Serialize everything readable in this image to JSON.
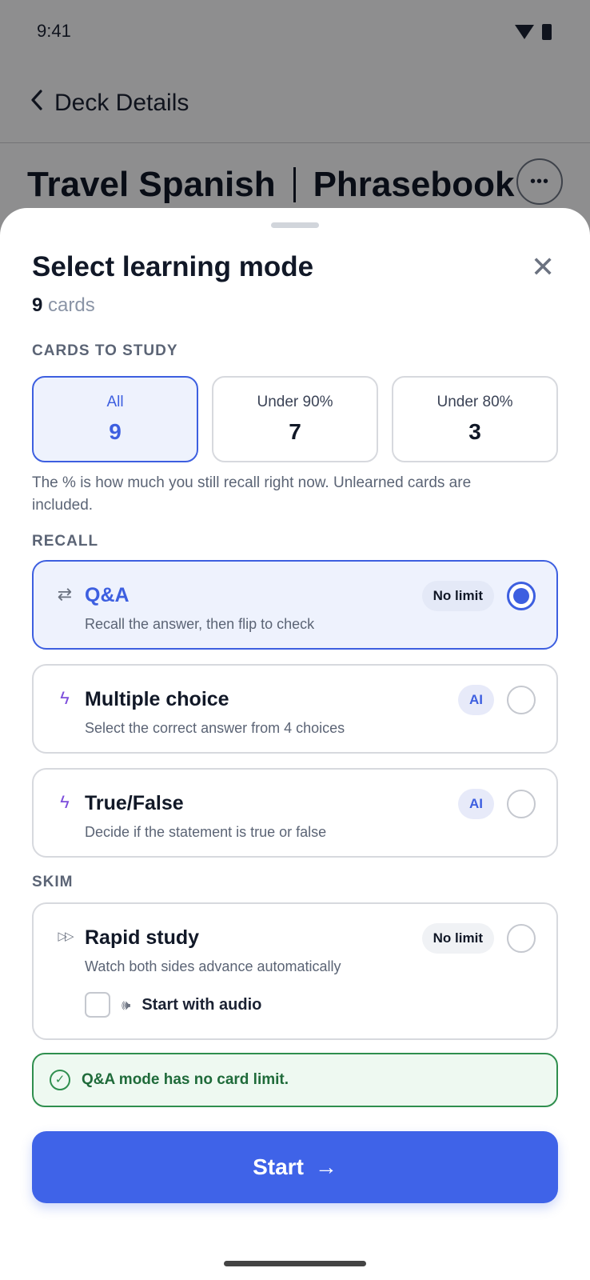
{
  "status_bar": {
    "time": "9:41"
  },
  "app_bar": {
    "back_icon": "chevron-left-icon",
    "title": "Deck Details"
  },
  "deck": {
    "title_left": "Travel Spanish",
    "title_right": "Phrasebook",
    "more_label": "•••"
  },
  "sheet": {
    "title": "Select learning mode",
    "close_label": "✕",
    "count_number": "9",
    "count_unit": "cards",
    "cards_to_study_label": "CARDS TO STUDY",
    "filters": [
      {
        "label": "All",
        "value": "9",
        "selected": true
      },
      {
        "label": "Under 90%",
        "value": "7",
        "selected": false
      },
      {
        "label": "Under 80%",
        "value": "3",
        "selected": false
      }
    ],
    "hint": "The % is how much you still recall right now. Unlearned cards are included.",
    "recall_label": "RECALL",
    "skim_label": "SKIM",
    "modes": [
      {
        "icon": "⇄",
        "icon_name": "swap-icon",
        "name": "Q&A",
        "desc": "Recall the answer, then flip to check",
        "badge": "No limit",
        "selected": true
      },
      {
        "icon": "ϟ",
        "icon_name": "lightning-icon",
        "name": "Multiple choice",
        "desc": "Select the correct answer from 4 choices",
        "badge": "AI",
        "selected": false
      },
      {
        "icon": "ϟ",
        "icon_name": "lightning-icon",
        "name": "True/False",
        "desc": "Decide if the statement is true or false",
        "badge": "AI",
        "selected": false
      },
      {
        "icon": "▷▷",
        "icon_name": "fast-forward-icon",
        "name": "Rapid study",
        "desc": "Watch both sides advance automatically",
        "badge": "No limit",
        "selected": false
      }
    ],
    "audio_option": {
      "label": "Start with audio",
      "icon": "🕪",
      "checked": false
    },
    "notice": {
      "icon": "✓",
      "text": "Q&A mode has no card limit."
    },
    "start_button": {
      "label": "Start",
      "arrow": "→"
    }
  },
  "colors": {
    "accent": "#3f63e8",
    "success": "#2f8f4e",
    "ai_purple": "#7c4ddb"
  }
}
